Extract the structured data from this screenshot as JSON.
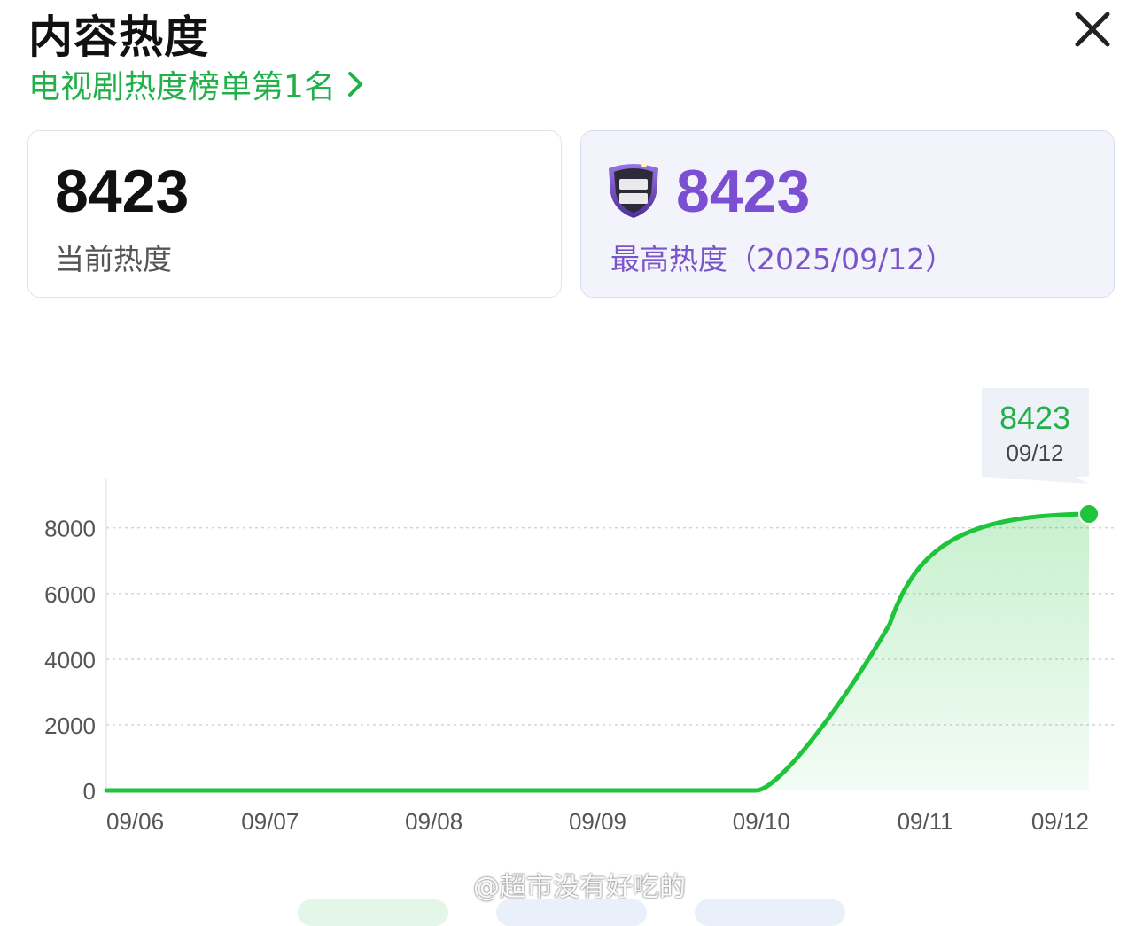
{
  "header": {
    "title": "内容热度",
    "rank_link": "电视剧热度榜单第1名"
  },
  "cards": {
    "current": {
      "value": "8423",
      "label": "当前热度"
    },
    "peak": {
      "value": "8423",
      "label": "最高热度（2025/09/12）",
      "badge_icon": "hall-of-fame-shield-icon"
    }
  },
  "colors": {
    "accent_green": "#22b04b",
    "line_green": "#1fc43c",
    "peak_purple": "#7a4fd1"
  },
  "chart_data": {
    "type": "area",
    "x": [
      "09/06",
      "09/07",
      "09/08",
      "09/09",
      "09/10",
      "09/11",
      "09/12"
    ],
    "series": [
      {
        "values": [
          0,
          0,
          0,
          0,
          0,
          7800,
          8423
        ]
      }
    ],
    "yticks": [
      "8000",
      "6000",
      "4000",
      "2000",
      "0"
    ],
    "ylim": [
      0,
      8423
    ],
    "grid": true,
    "tooltip": {
      "value": "8423",
      "date": "09/12"
    }
  },
  "watermark": {
    "text": "@超市没有好吃的"
  }
}
